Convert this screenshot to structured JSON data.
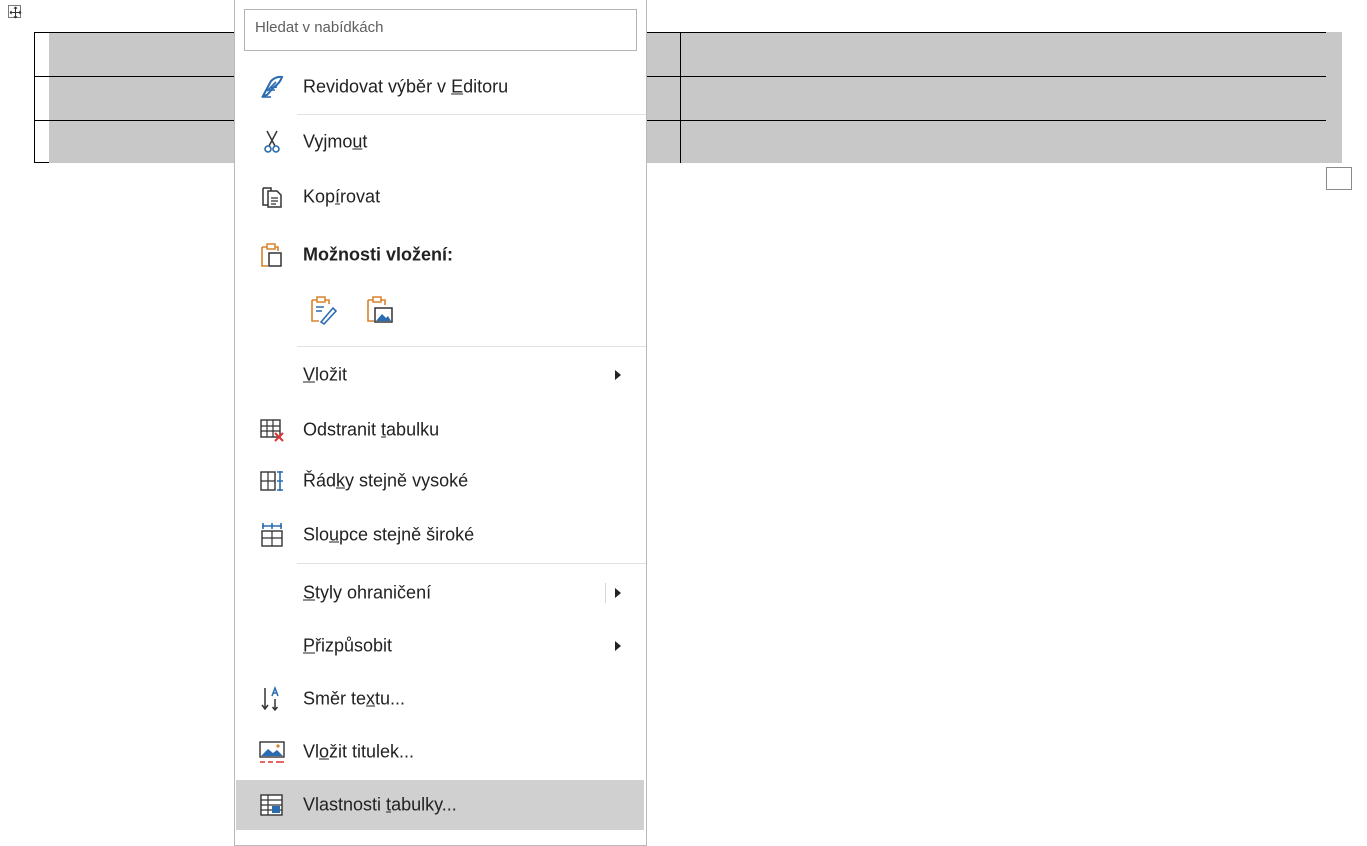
{
  "search": {
    "placeholder": "Hledat v nabídkách"
  },
  "menu": {
    "items": [
      {
        "label": "Revidovat výběr v Editoru",
        "icon": "editor-pen-icon"
      },
      {
        "label": "Vyjmout",
        "icon": "scissors-icon"
      },
      {
        "label": "Kopírovat",
        "icon": "copy-icon"
      },
      {
        "label": "Možnosti vložení:",
        "icon": "clipboard-icon"
      },
      {
        "label": "Vložit",
        "icon": ""
      },
      {
        "label": "Odstranit tabulku",
        "icon": "delete-table-icon"
      },
      {
        "label": "Řádky stejně vysoké",
        "icon": "distribute-rows-icon"
      },
      {
        "label": "Sloupce stejně široké",
        "icon": "distribute-columns-icon"
      },
      {
        "label": "Styly ohraničení",
        "icon": ""
      },
      {
        "label": "Přizpůsobit",
        "icon": ""
      },
      {
        "label": "Směr textu...",
        "icon": "text-direction-icon"
      },
      {
        "label": "Vložit titulek...",
        "icon": "insert-caption-icon"
      },
      {
        "label": "Vlastnosti tabulky...",
        "icon": "table-properties-icon"
      }
    ],
    "paste_options": [
      {
        "icon": "paste-keep-formatting-icon"
      },
      {
        "icon": "paste-picture-icon"
      }
    ]
  },
  "colors": {
    "selection": "#c8c8c8",
    "hover": "#d0d0d0",
    "accent_blue": "#2b6cb0",
    "accent_orange": "#d9822b"
  }
}
